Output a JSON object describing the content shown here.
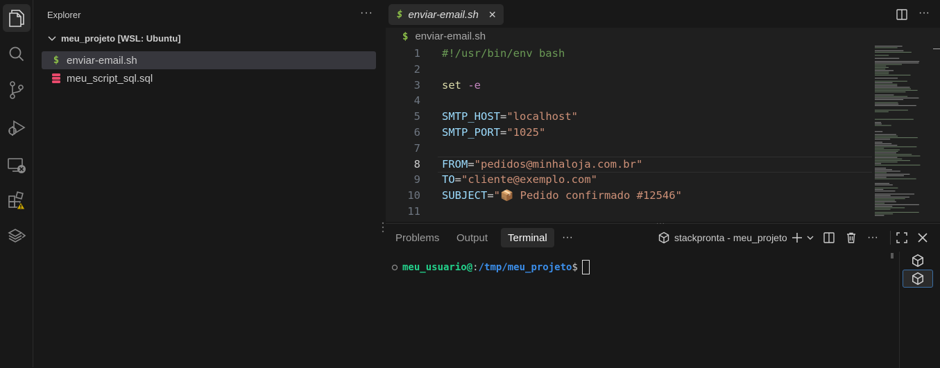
{
  "activity_bar": {
    "items": [
      {
        "name": "explorer",
        "icon": "files-icon",
        "active": true
      },
      {
        "name": "search",
        "icon": "search-icon"
      },
      {
        "name": "source-control",
        "icon": "source-control-icon"
      },
      {
        "name": "run-debug",
        "icon": "run-debug-icon"
      },
      {
        "name": "remote-explorer",
        "icon": "remote-explorer-icon"
      },
      {
        "name": "extensions",
        "icon": "extensions-icon",
        "badge": "warning"
      },
      {
        "name": "stackpronta",
        "icon": "stack-icon"
      }
    ]
  },
  "sidebar": {
    "title": "Explorer",
    "more": "···",
    "folder": "meu_projeto [WSL: Ubuntu]",
    "files": [
      {
        "name": "enviar-email.sh",
        "icon": "shell-file-icon",
        "selected": true
      },
      {
        "name": "meu_script_sql.sql",
        "icon": "database-file-icon",
        "selected": false
      }
    ]
  },
  "editor": {
    "tab": {
      "label": "enviar-email.sh",
      "icon": "shell-file-icon"
    },
    "breadcrumb": "enviar-email.sh",
    "current_line": 8,
    "lines": [
      {
        "n": "1",
        "segments": [
          {
            "t": "#!/usr/bin/env bash",
            "c": "c-com"
          }
        ]
      },
      {
        "n": "2",
        "segments": []
      },
      {
        "n": "3",
        "segments": [
          {
            "t": "set ",
            "c": "c-kw"
          },
          {
            "t": "-e",
            "c": "c-flag"
          }
        ]
      },
      {
        "n": "4",
        "segments": []
      },
      {
        "n": "5",
        "segments": [
          {
            "t": "SMTP_HOST",
            "c": "c-var"
          },
          {
            "t": "=",
            "c": "c-op"
          },
          {
            "t": "\"localhost\"",
            "c": "c-str"
          }
        ]
      },
      {
        "n": "6",
        "segments": [
          {
            "t": "SMTP_PORT",
            "c": "c-var"
          },
          {
            "t": "=",
            "c": "c-op"
          },
          {
            "t": "\"1025\"",
            "c": "c-str"
          }
        ]
      },
      {
        "n": "7",
        "segments": []
      },
      {
        "n": "8",
        "segments": [
          {
            "t": "FROM",
            "c": "c-var"
          },
          {
            "t": "=",
            "c": "c-op"
          },
          {
            "t": "\"pedidos@minhaloja.com.br\"",
            "c": "c-str"
          }
        ]
      },
      {
        "n": "9",
        "segments": [
          {
            "t": "TO",
            "c": "c-var"
          },
          {
            "t": "=",
            "c": "c-op"
          },
          {
            "t": "\"cliente@exemplo.com\"",
            "c": "c-str"
          }
        ]
      },
      {
        "n": "10",
        "segments": [
          {
            "t": "SUBJECT",
            "c": "c-var"
          },
          {
            "t": "=",
            "c": "c-op"
          },
          {
            "t": "\"📦 Pedido confirmado #12546\"",
            "c": "c-str"
          }
        ]
      },
      {
        "n": "11",
        "segments": []
      }
    ]
  },
  "panel": {
    "tabs": [
      "Problems",
      "Output",
      "Terminal"
    ],
    "active_tab": "Terminal",
    "more": "···",
    "terminal_name": "stackpronta - meu_projeto",
    "prompt": {
      "user": "meu_usuario@",
      "sep": ":",
      "path": "/tmp/meu_projeto",
      "symbol": "$"
    }
  },
  "colors": {
    "bg": "#181818",
    "editor_bg": "#1f1f1f",
    "accent": "#3a6ea5",
    "shell_icon": "#8dc149",
    "sql_icon": "#e8496b",
    "warning": "#cca700"
  }
}
